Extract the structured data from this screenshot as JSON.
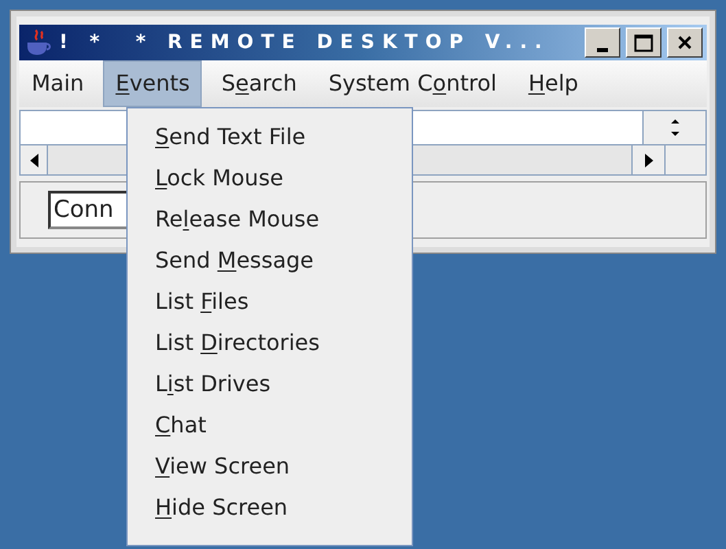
{
  "window": {
    "title": "! *  * REMOTE DESKTOP V..."
  },
  "menu_bar": [
    {
      "selected": false,
      "parts": [
        {
          "text": "Main",
          "underlined": false
        }
      ]
    },
    {
      "selected": true,
      "parts": [
        {
          "text": "E",
          "underlined": true
        },
        {
          "text": "vents",
          "underlined": false
        }
      ]
    },
    {
      "selected": false,
      "parts": [
        {
          "text": "S",
          "underlined": false
        },
        {
          "text": "e",
          "underlined": true
        },
        {
          "text": "arch",
          "underlined": false
        }
      ]
    },
    {
      "selected": false,
      "parts": [
        {
          "text": "System C",
          "underlined": false
        },
        {
          "text": "o",
          "underlined": true
        },
        {
          "text": "ntrol",
          "underlined": false
        }
      ]
    },
    {
      "selected": false,
      "parts": [
        {
          "text": "H",
          "underlined": true
        },
        {
          "text": "elp",
          "underlined": false
        }
      ]
    }
  ],
  "events_menu": [
    {
      "parts": [
        {
          "text": "S",
          "underlined": true
        },
        {
          "text": "end Text File",
          "underlined": false
        }
      ]
    },
    {
      "parts": [
        {
          "text": "L",
          "underlined": true
        },
        {
          "text": "ock Mouse",
          "underlined": false
        }
      ]
    },
    {
      "parts": [
        {
          "text": "Re",
          "underlined": false
        },
        {
          "text": "l",
          "underlined": true
        },
        {
          "text": "ease Mouse",
          "underlined": false
        }
      ]
    },
    {
      "parts": [
        {
          "text": "Send ",
          "underlined": false
        },
        {
          "text": "M",
          "underlined": true
        },
        {
          "text": "essage",
          "underlined": false
        }
      ]
    },
    {
      "parts": [
        {
          "text": "List ",
          "underlined": false
        },
        {
          "text": "F",
          "underlined": true
        },
        {
          "text": "iles",
          "underlined": false
        }
      ]
    },
    {
      "parts": [
        {
          "text": "List ",
          "underlined": false
        },
        {
          "text": "D",
          "underlined": true
        },
        {
          "text": "irectories",
          "underlined": false
        }
      ]
    },
    {
      "parts": [
        {
          "text": "L",
          "underlined": false
        },
        {
          "text": "i",
          "underlined": true
        },
        {
          "text": "st Drives",
          "underlined": false
        }
      ]
    },
    {
      "parts": [
        {
          "text": "C",
          "underlined": true
        },
        {
          "text": "hat",
          "underlined": false
        }
      ]
    },
    {
      "parts": [
        {
          "text": "V",
          "underlined": true
        },
        {
          "text": "iew Screen",
          "underlined": false
        }
      ]
    },
    {
      "parts": [
        {
          "text": "H",
          "underlined": true
        },
        {
          "text": "ide Screen",
          "underlined": false
        }
      ]
    }
  ],
  "status_field": {
    "value": "Conn"
  }
}
